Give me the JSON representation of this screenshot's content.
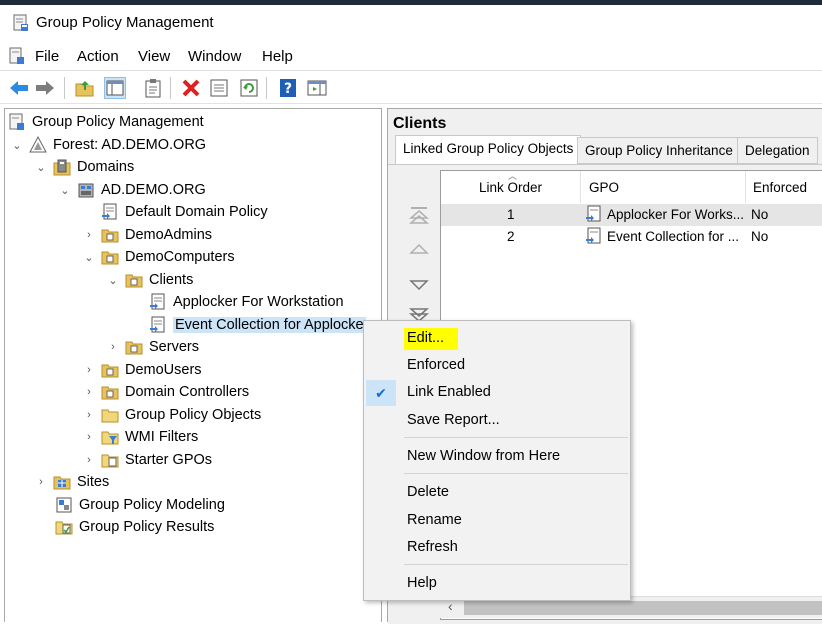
{
  "window": {
    "title": "Group Policy Management"
  },
  "menubar": {
    "items": [
      "File",
      "Action",
      "View",
      "Window",
      "Help"
    ]
  },
  "toolbar": {
    "buttons": [
      "back-arrow-icon",
      "forward-arrow-icon",
      "up-folder-icon",
      "show-hide-tree-icon",
      "clipboard-icon",
      "delete-icon",
      "properties-icon",
      "refresh-icon",
      "help-icon",
      "action-pane-icon"
    ]
  },
  "tree": {
    "root": "Group Policy Management",
    "forest": "Forest: AD.DEMO.ORG",
    "domains": "Domains",
    "domain": "AD.DEMO.ORG",
    "default_policy": "Default Domain Policy",
    "demo_admins": "DemoAdmins",
    "demo_computers": "DemoComputers",
    "clients": "Clients",
    "applocker": "Applocker For Workstation",
    "event_collection": "Event Collection for Applocke",
    "servers": "Servers",
    "demo_users": "DemoUsers",
    "domain_controllers": "Domain Controllers",
    "gpo": "Group Policy Objects",
    "wmi": "WMI Filters",
    "starter": "Starter GPOs",
    "sites": "Sites",
    "modeling": "Group Policy Modeling",
    "results": "Group Policy Results"
  },
  "details": {
    "heading": "Clients",
    "tabs": [
      "Linked Group Policy Objects",
      "Group Policy Inheritance",
      "Delegation"
    ],
    "columns": {
      "link_order": "Link Order",
      "gpo": "GPO",
      "enforced": "Enforced"
    },
    "rows": [
      {
        "order": "1",
        "gpo": "Applocker For Works...",
        "enforced": "No"
      },
      {
        "order": "2",
        "gpo": "Event Collection for ...",
        "enforced": "No"
      }
    ]
  },
  "context_menu": {
    "edit": "Edit...",
    "enforced": "Enforced",
    "link_enabled": "Link Enabled",
    "save_report": "Save Report...",
    "new_window": "New Window from Here",
    "delete": "Delete",
    "rename": "Rename",
    "refresh": "Refresh",
    "help": "Help"
  },
  "colors": {
    "selection": "#cce4f7",
    "highlight": "#ffff00",
    "check": "#1a6bd1"
  }
}
